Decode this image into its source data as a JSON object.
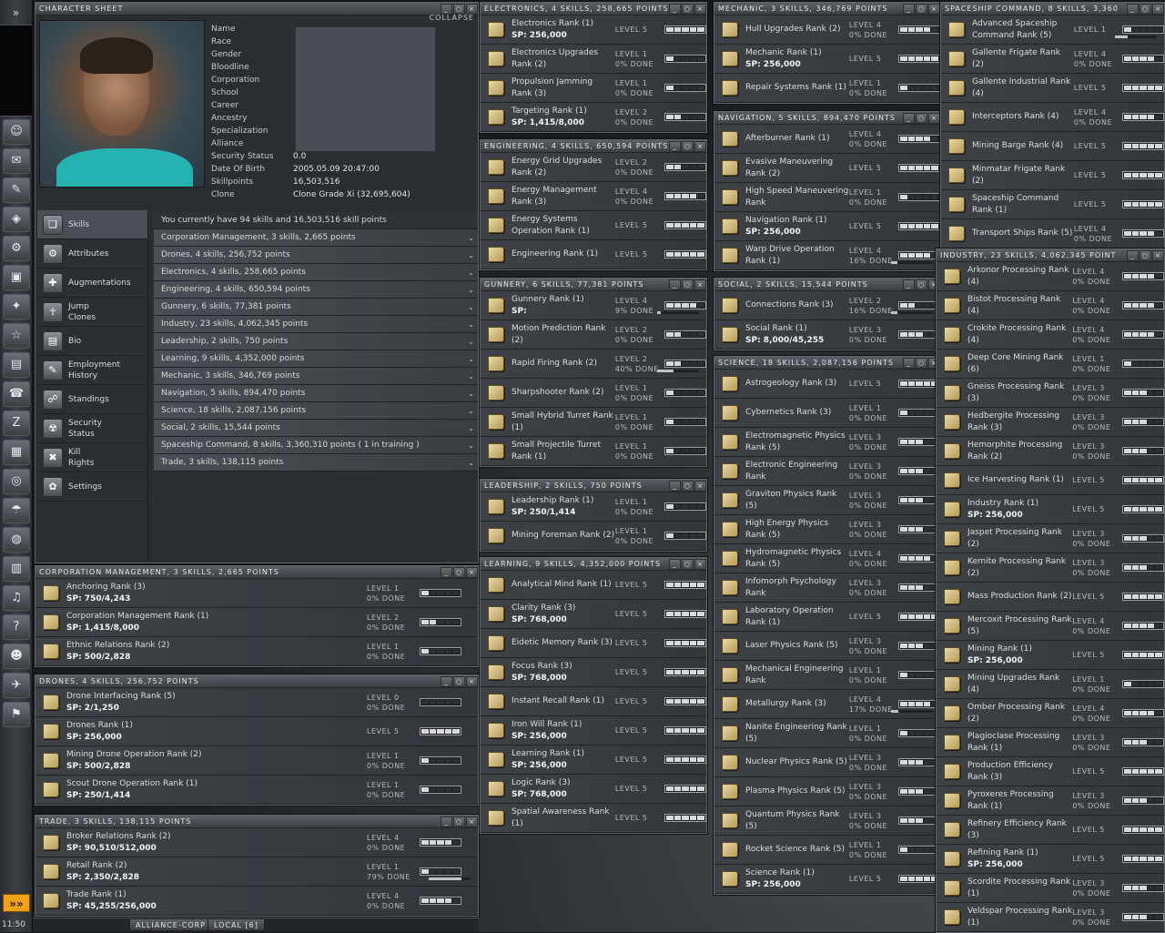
{
  "neocom": {
    "expand_label": "»",
    "time": "11:50",
    "buttons": [
      "☺",
      "✉",
      "✎",
      "◈",
      "⚙",
      "▣",
      "✦",
      "☆",
      "▤",
      "☎",
      "Z",
      "▦",
      "◎",
      "☂",
      "◍",
      "▥",
      "♫",
      "?",
      "☻",
      "✈",
      "⚑"
    ]
  },
  "character_sheet": {
    "title": "CHARACTER SHEET",
    "collapse": "COLLAPSE",
    "labels": [
      "Name",
      "Race",
      "Gender",
      "Bloodline",
      "Corporation",
      "School",
      "Career",
      "Ancestry",
      "Specialization",
      "Alliance",
      "Security Status",
      "Date Of Birth",
      "Skillpoints",
      "Clone"
    ],
    "values": {
      "security_status": "0.0",
      "date_of_birth": "2005.05.09  20:47:00",
      "skillpoints": "16,503,516",
      "clone": "Clone Grade Xi (32,695,604)"
    },
    "sidebar": [
      {
        "label": "Skills",
        "icon": "book-icon",
        "g": "❏"
      },
      {
        "label": "Attributes",
        "icon": "brain-icon",
        "g": "⚙"
      },
      {
        "label": "Augmentations",
        "icon": "implant-icon",
        "g": "✚"
      },
      {
        "label": "Jump\nClones",
        "icon": "clone-icon",
        "g": "☥"
      },
      {
        "label": "Bio",
        "icon": "bio-icon",
        "g": "▤"
      },
      {
        "label": "Employment\nHistory",
        "icon": "history-icon",
        "g": "✎"
      },
      {
        "label": "Standings",
        "icon": "standings-icon",
        "g": "☍"
      },
      {
        "label": "Security\nStatus",
        "icon": "security-icon",
        "g": "☢"
      },
      {
        "label": "Kill\nRights",
        "icon": "kill-icon",
        "g": "✖"
      },
      {
        "label": "Settings",
        "icon": "settings-icon",
        "g": "✿"
      }
    ],
    "summary": "You currently have 94 skills and 16,503,516 skill points",
    "groups": [
      "Corporation Management, 3 skills, 2,665 points",
      "Drones, 4 skills, 256,752 points",
      "Electronics, 4 skills, 258,665 points",
      "Engineering, 4 skills, 650,594 points",
      "Gunnery, 6 skills, 77,381 points",
      "Industry, 23 skills, 4,062,345 points",
      "Leadership, 2 skills, 750 points",
      "Learning, 9 skills, 4,352,000 points",
      "Mechanic, 3 skills, 346,769 points",
      "Navigation, 5 skills, 894,470 points",
      "Science, 18 skills, 2,087,156 points",
      "Social, 2 skills, 15,544 points",
      "Spaceship Command, 8 skills, 3,360,310 points ( 1 in training )",
      "Trade, 3 skills, 138,115 points"
    ]
  },
  "windows": [
    {
      "title": "CORPORATION MANAGEMENT, 3 SKILLS, 2,665 POINTS",
      "skills": [
        {
          "name": "Anchoring Rank (3)",
          "sp": "SP: 750/4,243",
          "level": 1,
          "done": "0% DONE"
        },
        {
          "name": "Corporation Management Rank (1)",
          "sp": "SP: 1,415/8,000",
          "level": 2,
          "done": "0% DONE"
        },
        {
          "name": "Ethnic Relations Rank (2)",
          "sp": "SP: 500/2,828",
          "level": 1,
          "done": "0% DONE"
        }
      ]
    },
    {
      "title": "DRONES, 4 SKILLS, 256,752 POINTS",
      "skills": [
        {
          "name": "Drone Interfacing Rank (5)",
          "sp": "SP: 2/1,250",
          "level": 0,
          "done": "0% DONE"
        },
        {
          "name": "Drones Rank (1)",
          "sp": "SP: 256,000",
          "level": 5
        },
        {
          "name": "Mining Drone Operation Rank (2)",
          "sp": "SP: 500/2,828",
          "level": 1,
          "done": "0% DONE"
        },
        {
          "name": "Scout Drone Operation Rank (1)",
          "sp": "SP: 250/1,414",
          "level": 1,
          "done": "0% DONE"
        }
      ]
    },
    {
      "title": "TRADE, 3 SKILLS, 138,115 POINTS",
      "skills": [
        {
          "name": "Broker Relations Rank (2)",
          "sp": "SP: 90,510/512,000",
          "level": 4,
          "done": "0% DONE"
        },
        {
          "name": "Retail Rank (2)",
          "sp": "SP: 2,350/2,828",
          "level": 1,
          "done": "79% DONE",
          "prog": 79
        },
        {
          "name": "Trade Rank (1)",
          "sp": "SP: 45,255/256,000",
          "level": 4,
          "done": "0% DONE"
        }
      ]
    },
    {
      "title": "ELECTRONICS, 4 SKILLS, 258,665 POINTS",
      "skills": [
        {
          "name": "Electronics Rank (1)",
          "sp": "SP: 256,000",
          "level": 5
        },
        {
          "name": "Electronics Upgrades Rank (2)",
          "level": 1,
          "done": "0% DONE"
        },
        {
          "name": "Propulsion Jamming Rank (3)",
          "level": 1,
          "done": "0% DONE"
        },
        {
          "name": "Targeting Rank (1)",
          "sp": "SP: 1,415/8,000",
          "level": 2,
          "done": "0% DONE"
        }
      ]
    },
    {
      "title": "ENGINEERING, 4 SKILLS, 650,594 POINTS",
      "skills": [
        {
          "name": "Energy Grid Upgrades Rank (2)",
          "level": 2,
          "done": "0% DONE"
        },
        {
          "name": "Energy Management Rank (3)",
          "level": 4,
          "done": "0% DONE"
        },
        {
          "name": "Energy Systems Operation Rank (1)",
          "level": 5
        },
        {
          "name": "Engineering Rank (1)",
          "level": 5
        }
      ]
    },
    {
      "title": "GUNNERY, 6 SKILLS, 77,381 POINTS",
      "skills": [
        {
          "name": "Gunnery Rank (1)",
          "sp": "SP:",
          "level": 4,
          "done": "9% DONE",
          "prog": 9
        },
        {
          "name": "Motion Prediction Rank (2)",
          "level": 2,
          "done": "0% DONE"
        },
        {
          "name": "Rapid Firing Rank (2)",
          "level": 2,
          "done": "40% DONE",
          "prog": 40
        },
        {
          "name": "Sharpshooter Rank (2)",
          "level": 1,
          "done": "0% DONE"
        },
        {
          "name": "Small Hybrid Turret Rank (1)",
          "level": 1,
          "done": "0% DONE"
        },
        {
          "name": "Small Projectile Turret Rank (1)",
          "level": 1,
          "done": "0% DONE"
        }
      ]
    },
    {
      "title": "LEADERSHIP, 2 SKILLS, 750 POINTS",
      "skills": [
        {
          "name": "Leadership Rank (1)",
          "sp": "SP: 250/1,414",
          "level": 1,
          "done": "0% DONE"
        },
        {
          "name": "Mining Foreman Rank (2)",
          "level": 1,
          "done": "0% DONE"
        }
      ]
    },
    {
      "title": "LEARNING, 9 SKILLS, 4,352,000 POINTS",
      "skills": [
        {
          "name": "Analytical Mind Rank (1)",
          "level": 5
        },
        {
          "name": "Clarity Rank (3)",
          "sp": "SP: 768,000",
          "level": 5
        },
        {
          "name": "Eidetic Memory Rank (3)",
          "level": 5
        },
        {
          "name": "Focus Rank (3)",
          "sp": "SP: 768,000",
          "level": 5
        },
        {
          "name": "Instant Recall Rank (1)",
          "level": 5
        },
        {
          "name": "Iron Will Rank (1)",
          "sp": "SP: 256,000",
          "level": 5
        },
        {
          "name": "Learning Rank (1)",
          "sp": "SP: 256,000",
          "level": 5
        },
        {
          "name": "Logic Rank (3)",
          "sp": "SP: 768,000",
          "level": 5
        },
        {
          "name": "Spatial Awareness Rank (1)",
          "level": 5
        }
      ]
    },
    {
      "title": "MECHANIC, 3 SKILLS, 346,769 POINTS",
      "skills": [
        {
          "name": "Hull Upgrades Rank (2)",
          "level": 4,
          "done": "0% DONE"
        },
        {
          "name": "Mechanic Rank (1)",
          "sp": "SP: 256,000",
          "level": 5
        },
        {
          "name": "Repair Systems Rank (1)",
          "level": 1,
          "done": "0% DONE"
        }
      ]
    },
    {
      "title": "NAVIGATION, 5 SKILLS, 894,470 POINTS",
      "skills": [
        {
          "name": "Afterburner Rank (1)",
          "level": 4,
          "done": "0% DONE"
        },
        {
          "name": "Evasive Maneuvering Rank (2)",
          "level": 5
        },
        {
          "name": "High Speed Maneuvering Rank",
          "level": 1,
          "done": "0% DONE"
        },
        {
          "name": "Navigation Rank (1)",
          "sp": "SP: 256,000",
          "level": 5
        },
        {
          "name": "Warp Drive Operation Rank (1)",
          "level": 4,
          "done": "16% DONE",
          "prog": 16
        }
      ]
    },
    {
      "title": "SOCIAL, 2 SKILLS, 15,544 POINTS",
      "skills": [
        {
          "name": "Connections Rank (3)",
          "level": 2,
          "done": "16% DONE",
          "prog": 16
        },
        {
          "name": "Social Rank (1)",
          "sp": "SP: 8,000/45,255",
          "level": 3,
          "done": "0% DONE"
        }
      ]
    },
    {
      "title": "SCIENCE, 18 SKILLS, 2,087,156 POINTS",
      "skills": [
        {
          "name": "Astrogeology Rank (3)",
          "level": 5
        },
        {
          "name": "Cybernetics Rank (3)",
          "level": 1,
          "done": "0% DONE"
        },
        {
          "name": "Electromagnetic Physics Rank (5)",
          "level": 3,
          "done": "0% DONE"
        },
        {
          "name": "Electronic Engineering Rank",
          "level": 3,
          "done": "0% DONE"
        },
        {
          "name": "Graviton Physics Rank (5)",
          "level": 3,
          "done": "0% DONE"
        },
        {
          "name": "High Energy Physics Rank (5)",
          "level": 3,
          "done": "0% DONE"
        },
        {
          "name": "Hydromagnetic Physics Rank (5)",
          "level": 4,
          "done": "0% DONE"
        },
        {
          "name": "Infomorph Psychology Rank",
          "level": 3,
          "done": "0% DONE"
        },
        {
          "name": "Laboratory Operation Rank (1)",
          "level": 5
        },
        {
          "name": "Laser Physics Rank (5)",
          "level": 3,
          "done": "0% DONE"
        },
        {
          "name": "Mechanical Engineering Rank",
          "level": 1,
          "done": "0% DONE"
        },
        {
          "name": "Metallurgy Rank (3)",
          "level": 4,
          "done": "17% DONE",
          "prog": 17
        },
        {
          "name": "Nanite Engineering Rank (5)",
          "level": 1,
          "done": "0% DONE"
        },
        {
          "name": "Nuclear Physics Rank (5)",
          "level": 3,
          "done": "0% DONE"
        },
        {
          "name": "Plasma Physics Rank (5)",
          "level": 3,
          "done": "0% DONE"
        },
        {
          "name": "Quantum Physics Rank (5)",
          "level": 3,
          "done": "0% DONE"
        },
        {
          "name": "Rocket Science Rank (5)",
          "level": 1,
          "done": "0% DONE"
        },
        {
          "name": "Science Rank (1)",
          "sp": "SP: 256,000",
          "level": 5
        }
      ]
    },
    {
      "title": "SPACESHIP COMMAND, 8 SKILLS, 3,360",
      "skills": [
        {
          "name": "Advanced Spaceship Command Rank (5)",
          "level": 1,
          "prog": 30
        },
        {
          "name": "Gallente Frigate Rank (2)",
          "level": 4,
          "done": "0% DONE"
        },
        {
          "name": "Gallente Industrial Rank (4)",
          "level": 5
        },
        {
          "name": "Interceptors Rank (4)",
          "level": 4,
          "done": "0% DONE"
        },
        {
          "name": "Mining Barge Rank (4)",
          "level": 5
        },
        {
          "name": "Minmatar Frigate Rank (2)",
          "level": 5
        },
        {
          "name": "Spaceship Command Rank (1)",
          "level": 5
        },
        {
          "name": "Transport Ships Rank (5)",
          "level": 4,
          "done": "0% DONE"
        }
      ]
    },
    {
      "title": "INDUSTRY, 23 SKILLS, 4,062,345 POINT",
      "skills": [
        {
          "name": "Arkonor Processing Rank (4)",
          "level": 4,
          "done": "0% DONE"
        },
        {
          "name": "Bistot Processing Rank (4)",
          "level": 4,
          "done": "0% DONE"
        },
        {
          "name": "Crokite Processing Rank (4)",
          "level": 4,
          "done": "0% DONE"
        },
        {
          "name": "Deep Core Mining Rank (6)",
          "level": 1,
          "done": "0% DONE"
        },
        {
          "name": "Gneiss Processing Rank (3)",
          "level": 3,
          "done": "0% DONE"
        },
        {
          "name": "Hedbergite Processing Rank (3)",
          "level": 3,
          "done": "0% DONE"
        },
        {
          "name": "Hemorphite Processing Rank (2)",
          "level": 3,
          "done": "0% DONE"
        },
        {
          "name": "Ice Harvesting Rank (1)",
          "level": 5
        },
        {
          "name": "Industry Rank (1)",
          "sp": "SP: 256,000",
          "level": 5
        },
        {
          "name": "Jaspet Processing Rank (2)",
          "level": 3,
          "done": "0% DONE"
        },
        {
          "name": "Kernite Processing Rank (2)",
          "level": 3,
          "done": "0% DONE"
        },
        {
          "name": "Mass Production Rank (2)",
          "level": 5
        },
        {
          "name": "Mercoxit Processing Rank (5)",
          "level": 4,
          "done": "0% DONE"
        },
        {
          "name": "Mining Rank (1)",
          "sp": "SP: 256,000",
          "level": 5
        },
        {
          "name": "Mining Upgrades Rank (4)",
          "level": 1,
          "done": "0% DONE"
        },
        {
          "name": "Omber Processing Rank (2)",
          "level": 4,
          "done": "0% DONE"
        },
        {
          "name": "Plagioclase Processing Rank (1)",
          "level": 3,
          "done": "0% DONE"
        },
        {
          "name": "Production Efficiency Rank (3)",
          "level": 5
        },
        {
          "name": "Pyroxeres Processing Rank (1)",
          "level": 3,
          "done": "0% DONE"
        },
        {
          "name": "Refinery Efficiency Rank (3)",
          "level": 5
        },
        {
          "name": "Refining Rank (1)",
          "sp": "SP: 256,000",
          "level": 5
        },
        {
          "name": "Scordite Processing Rank (1)",
          "level": 3,
          "done": "0% DONE"
        },
        {
          "name": "Veldspar Processing Rank (1)",
          "level": 3,
          "done": "0% DONE"
        }
      ]
    }
  ],
  "chat": {
    "tabs": [
      "ALLIANCE-CORP",
      "LOCAL [6]"
    ]
  },
  "level_prefix": "LEVEL"
}
